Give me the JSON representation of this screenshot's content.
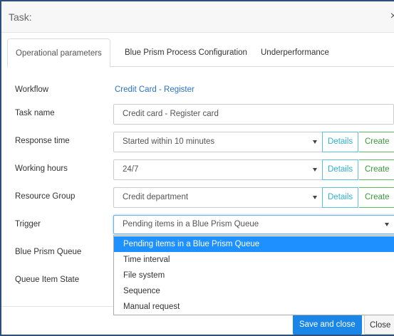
{
  "modal": {
    "title": "Task:",
    "close_glyph": "×"
  },
  "tabs": [
    {
      "label": "Operational parameters",
      "active": true
    },
    {
      "label": "Blue Prism Process Configuration",
      "active": false
    },
    {
      "label": "Underperformance",
      "active": false
    }
  ],
  "form": {
    "workflow": {
      "label": "Workflow",
      "value": "Credit Card - Register"
    },
    "task_name": {
      "label": "Task name",
      "value": "Credit card - Register card"
    },
    "response_time": {
      "label": "Response time",
      "value": "Started within 10 minutes",
      "details": "Details",
      "create": "Create"
    },
    "working_hours": {
      "label": "Working hours",
      "value": "24/7",
      "details": "Details",
      "create": "Create"
    },
    "resource_group": {
      "label": "Resource Group",
      "value": "Credit department",
      "details": "Details",
      "create": "Create"
    },
    "trigger": {
      "label": "Trigger",
      "value": "Pending items in a Blue Prism Queue"
    },
    "blue_prism_queue": {
      "label": "Blue Prism Queue"
    },
    "queue_item_state": {
      "label": "Queue Item State"
    }
  },
  "trigger_dropdown": {
    "options": [
      "Pending items in a Blue Prism Queue",
      "Time interval",
      "File system",
      "Sequence",
      "Manual request"
    ],
    "selected_index": 0,
    "highlight_color": "#1e90ff"
  },
  "footer": {
    "save": "Save and close",
    "close": "Close"
  },
  "icons": {
    "caret": "caret-down-icon",
    "close": "close-icon"
  }
}
